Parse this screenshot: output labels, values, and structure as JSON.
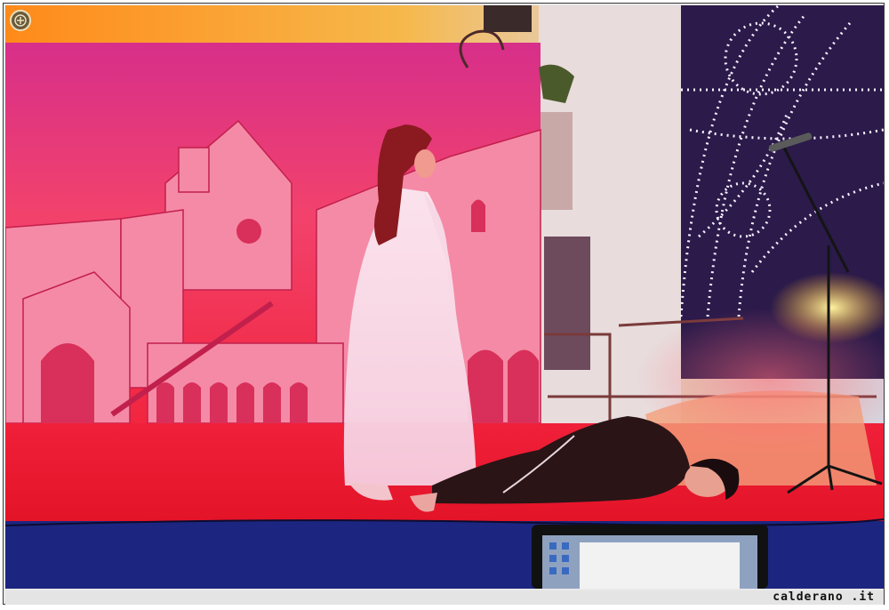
{
  "photo": {
    "description_alt": "",
    "credit": "calderano .it"
  },
  "icons": {
    "logo": "seal-icon"
  },
  "colors": {
    "stage_red": "#e8102a",
    "backdrop_pink": "#f0386a",
    "stage_blue": "#1e2a8a",
    "lights": "#f4f0ff"
  }
}
